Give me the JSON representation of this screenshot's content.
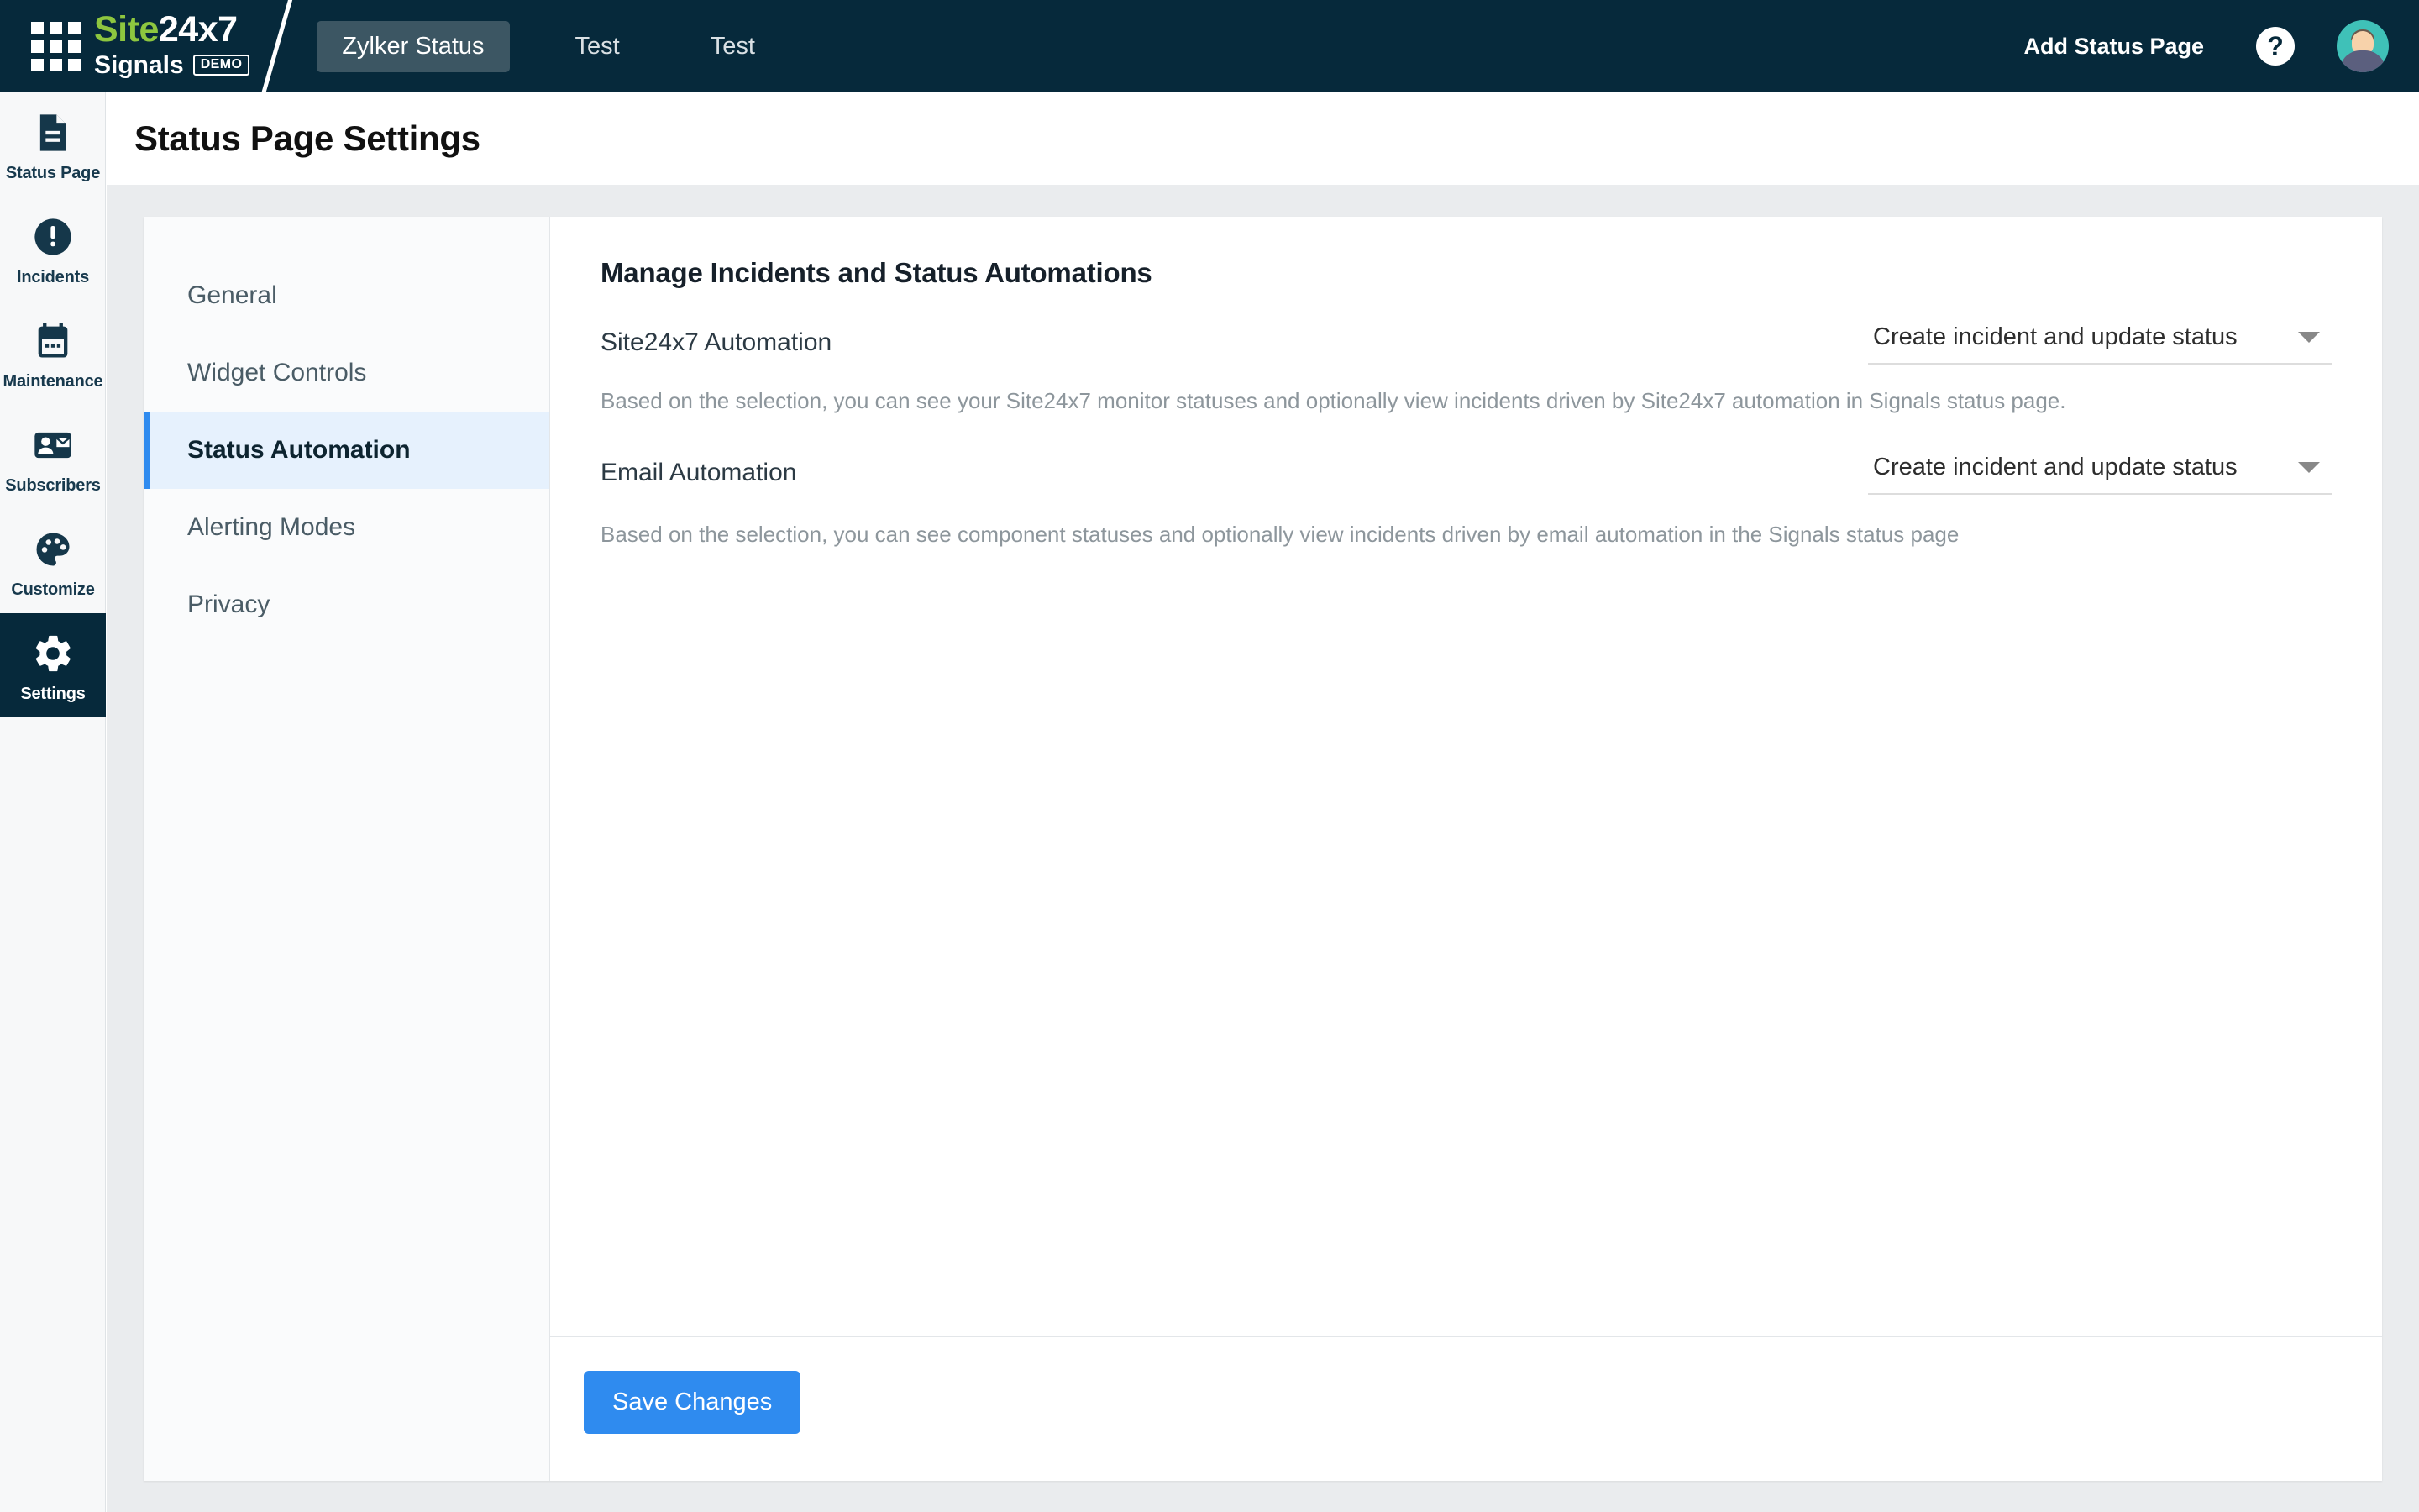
{
  "topbar": {
    "apps_icon": "grid-apps-icon",
    "brand": {
      "line1_prefix": "Site",
      "line1_suffix": "24x7",
      "line2": "Signals",
      "badge": "DEMO"
    },
    "tabs": [
      {
        "label": "Zylker Status",
        "active": true
      },
      {
        "label": "Test",
        "active": false
      },
      {
        "label": "Test",
        "active": false
      }
    ],
    "add_status_page": "Add Status Page",
    "help_icon": "question-mark-icon",
    "help_glyph": "?",
    "avatar": "user-avatar"
  },
  "rail": {
    "items": [
      {
        "label": "Status Page",
        "icon": "document-icon",
        "active": false
      },
      {
        "label": "Incidents",
        "icon": "alert-circle-icon",
        "active": false
      },
      {
        "label": "Maintenance",
        "icon": "calendar-icon",
        "active": false
      },
      {
        "label": "Subscribers",
        "icon": "contact-card-icon",
        "active": false
      },
      {
        "label": "Customize",
        "icon": "palette-icon",
        "active": false
      },
      {
        "label": "Settings",
        "icon": "gear-icon",
        "active": true
      }
    ]
  },
  "page": {
    "title": "Status Page Settings"
  },
  "submenu": {
    "items": [
      {
        "label": "General",
        "active": false
      },
      {
        "label": "Widget Controls",
        "active": false
      },
      {
        "label": "Status Automation",
        "active": true
      },
      {
        "label": "Alerting Modes",
        "active": false
      },
      {
        "label": "Privacy",
        "active": false
      }
    ]
  },
  "main": {
    "heading": "Manage Incidents and Status Automations",
    "rows": [
      {
        "label": "Site24x7 Automation",
        "select_value": "Create incident and update status",
        "help": "Based on the selection, you can see your Site24x7 monitor statuses and optionally view incidents driven by Site24x7 automation in Signals status page."
      },
      {
        "label": "Email Automation",
        "select_value": "Create incident and update status",
        "help": "Based on the selection, you can see component statuses and optionally view incidents driven by email automation in the Signals status page"
      }
    ],
    "save_label": "Save Changes"
  },
  "colors": {
    "topbar_bg": "#06293b",
    "accent_blue": "#2f8bef",
    "brand_green": "#8dc63f",
    "active_submenu_bg": "#e6f1fd",
    "body_bg": "#eaecee"
  }
}
